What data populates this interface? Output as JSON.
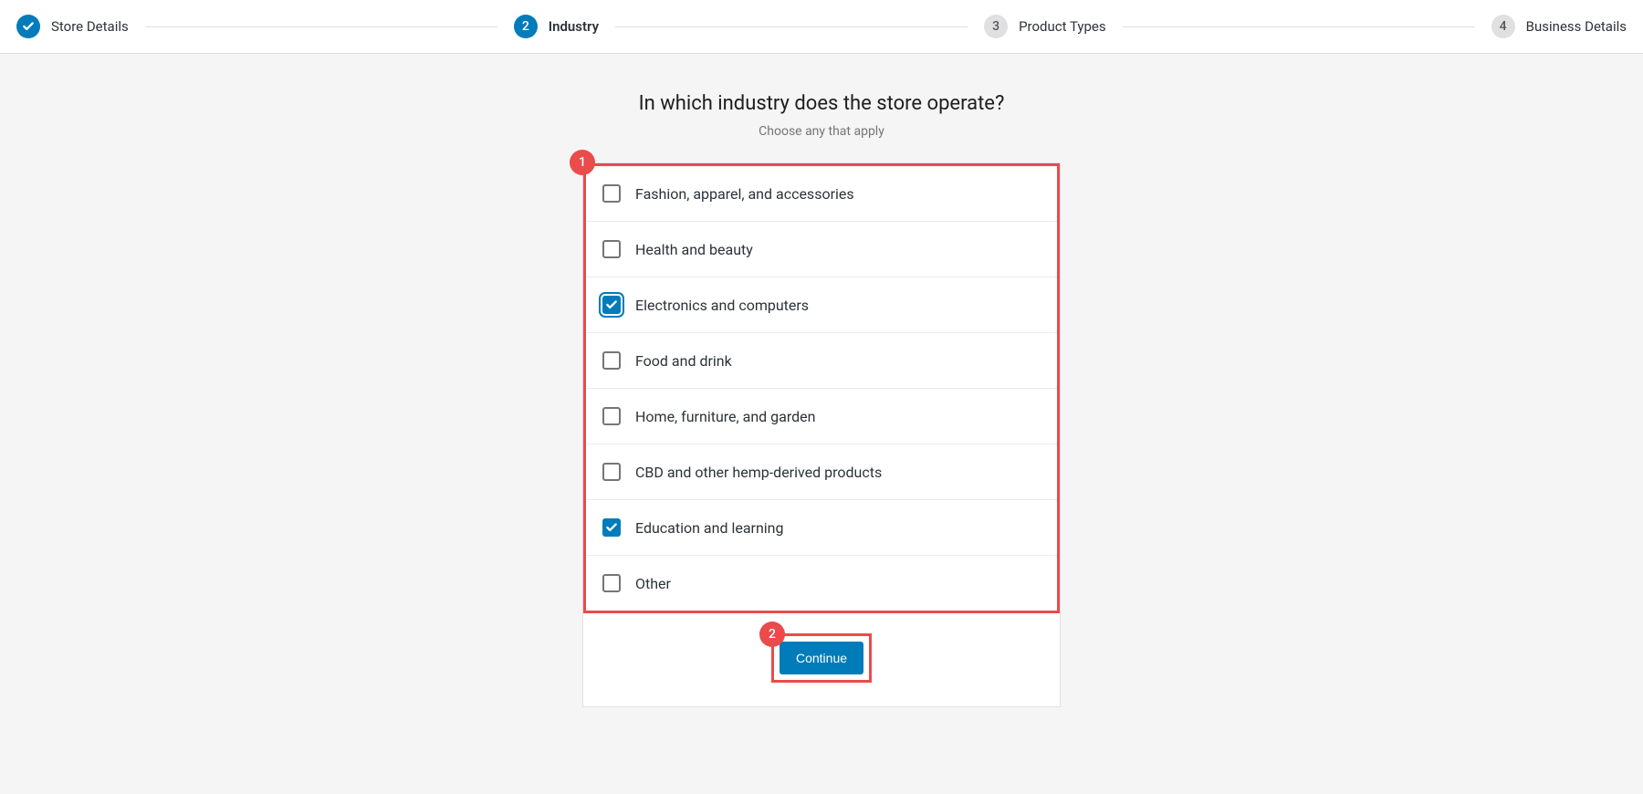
{
  "stepper": {
    "steps": [
      {
        "label": "Store Details",
        "state": "completed"
      },
      {
        "label": "Industry",
        "state": "active",
        "number": "2"
      },
      {
        "label": "Product Types",
        "state": "pending",
        "number": "3"
      },
      {
        "label": "Business Details",
        "state": "pending",
        "number": "4"
      }
    ]
  },
  "main": {
    "title": "In which industry does the store operate?",
    "subtitle": "Choose any that apply",
    "options": [
      {
        "label": "Fashion, apparel, and accessories",
        "checked": false,
        "focus": false
      },
      {
        "label": "Health and beauty",
        "checked": false,
        "focus": false
      },
      {
        "label": "Electronics and computers",
        "checked": true,
        "focus": true
      },
      {
        "label": "Food and drink",
        "checked": false,
        "focus": false
      },
      {
        "label": "Home, furniture, and garden",
        "checked": false,
        "focus": false
      },
      {
        "label": "CBD and other hemp-derived products",
        "checked": false,
        "focus": false
      },
      {
        "label": "Education and learning",
        "checked": true,
        "focus": false
      },
      {
        "label": "Other",
        "checked": false,
        "focus": false
      }
    ],
    "continue_label": "Continue"
  },
  "annotations": {
    "badge1": "1",
    "badge2": "2"
  }
}
